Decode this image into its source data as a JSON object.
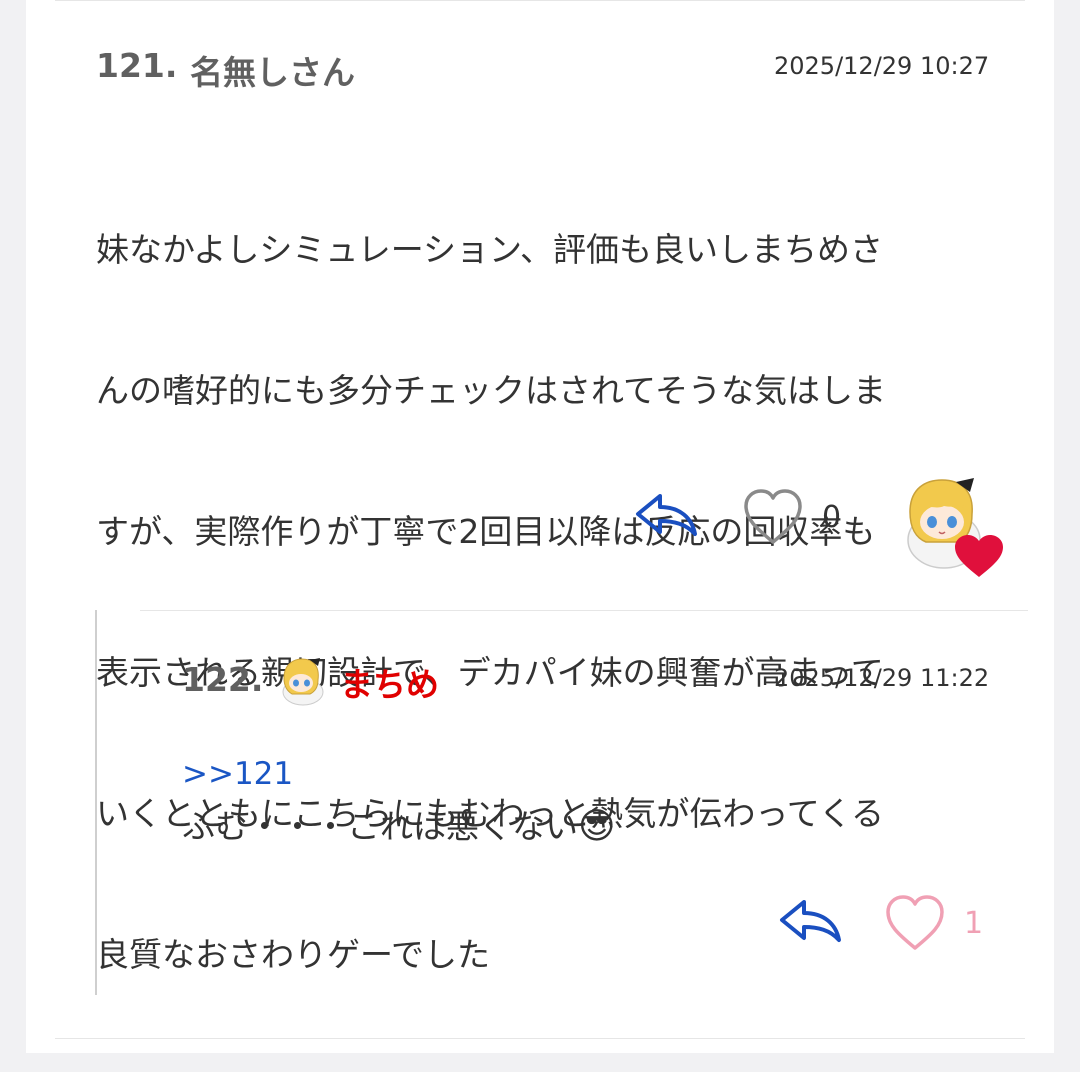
{
  "comments": [
    {
      "number": "121.",
      "author": "名無しさん",
      "timestamp": "2025/12/29 10:27",
      "lines": [
        "妹なかよしシミュレーション、評価も良いしまちめさ",
        "んの嗜好的にも多分チェックはされてそうな気はしま",
        "すが、実際作りが丁寧で2回目以降は反応の回収率も",
        "表示される親切設計で、デカパイ妹の興奮が高まって",
        "いくとともにこちらにもむわっと熱気が伝わってくる",
        "良質なおさわりゲーでした"
      ],
      "likes": "0",
      "author_liked": true
    },
    {
      "number": "122.",
      "author": "まちめ",
      "timestamp": "2025/12/29 11:22",
      "anchor": ">>121",
      "text": "ふむ・・・これは悪くない",
      "emoji": "😎",
      "likes": "1"
    }
  ],
  "colors": {
    "reply_icon": "#1a4fc0",
    "heart_gray": "#8a8a8a",
    "heart_pink": "#f0a0b4",
    "heart_red": "#e0103c",
    "author_red": "#e00000",
    "anchor_blue": "#1a56c4"
  }
}
